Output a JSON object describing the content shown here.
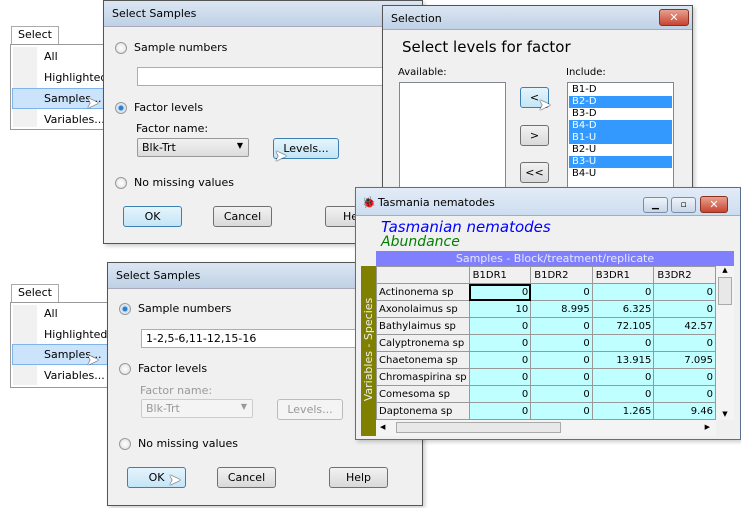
{
  "menu": {
    "title": "Select",
    "items": [
      "All",
      "Highlighted",
      "Samples...",
      "Variables..."
    ],
    "selected": "Samples..."
  },
  "dialog_top": {
    "title": "Select Samples",
    "radio_sample_numbers": "Sample numbers",
    "sample_numbers_value": "",
    "radio_factor_levels": "Factor levels",
    "factor_name_label": "Factor name:",
    "factor_name_value": "Blk-Trt",
    "levels_button": "Levels...",
    "radio_no_missing": "No missing values",
    "selected_option": "Factor levels",
    "ok": "OK",
    "cancel": "Cancel",
    "help": "He"
  },
  "selection_dialog": {
    "title": "Selection",
    "heading": "Select levels for factor",
    "available_label": "Available:",
    "include_label": "Include:",
    "available_items": [],
    "include_items": [
      {
        "label": "B1-D",
        "selected": false
      },
      {
        "label": "B2-D",
        "selected": true
      },
      {
        "label": "B3-D",
        "selected": false
      },
      {
        "label": "B4-D",
        "selected": true
      },
      {
        "label": "B1-U",
        "selected": true
      },
      {
        "label": "B2-U",
        "selected": false
      },
      {
        "label": "B3-U",
        "selected": true
      },
      {
        "label": "B4-U",
        "selected": false
      }
    ],
    "move_left": "<",
    "move_right": ">",
    "move_all_left": "<<"
  },
  "data_window": {
    "title": "Tasmania nematodes",
    "dataset_title": "Tasmanian nematodes",
    "data_type": "Abundance",
    "samples_header": "Samples - Block/treatment/replicate",
    "variables_header": "Variables - Species",
    "columns": [
      "B1DR1",
      "B1DR2",
      "B3DR1",
      "B3DR2"
    ],
    "rows": [
      {
        "name": "Actinonema sp",
        "values": [
          "0",
          "0",
          "0",
          "0"
        ]
      },
      {
        "name": "Axonolaimus sp",
        "values": [
          "10",
          "8.995",
          "6.325",
          "0"
        ]
      },
      {
        "name": "Bathylaimus sp",
        "values": [
          "0",
          "0",
          "72.105",
          "42.57"
        ]
      },
      {
        "name": "Calyptronema sp",
        "values": [
          "0",
          "0",
          "0",
          "0"
        ]
      },
      {
        "name": "Chaetonema sp",
        "values": [
          "0",
          "0",
          "13.915",
          "7.095"
        ]
      },
      {
        "name": "Chromaspirina sp",
        "values": [
          "0",
          "0",
          "0",
          "0"
        ]
      },
      {
        "name": "Comesoma sp",
        "values": [
          "0",
          "0",
          "0",
          "0"
        ]
      },
      {
        "name": "Daptonema sp",
        "values": [
          "0",
          "0",
          "1.265",
          "9.46"
        ]
      }
    ],
    "colors": {
      "samples_header": "#8080ff",
      "variables_header": "#808000",
      "cells": "#c0ffff",
      "title_text": "#0000ff",
      "type_text": "#008000"
    }
  },
  "dialog_bottom": {
    "title": "Select Samples",
    "radio_sample_numbers": "Sample numbers",
    "sample_numbers_value": "1-2,5-6,11-12,15-16",
    "radio_factor_levels": "Factor levels",
    "factor_name_label": "Factor name:",
    "factor_name_value": "Blk-Trt",
    "levels_button": "Levels...",
    "radio_no_missing": "No missing values",
    "selected_option": "Sample numbers",
    "ok": "OK",
    "cancel": "Cancel",
    "help": "Help"
  }
}
